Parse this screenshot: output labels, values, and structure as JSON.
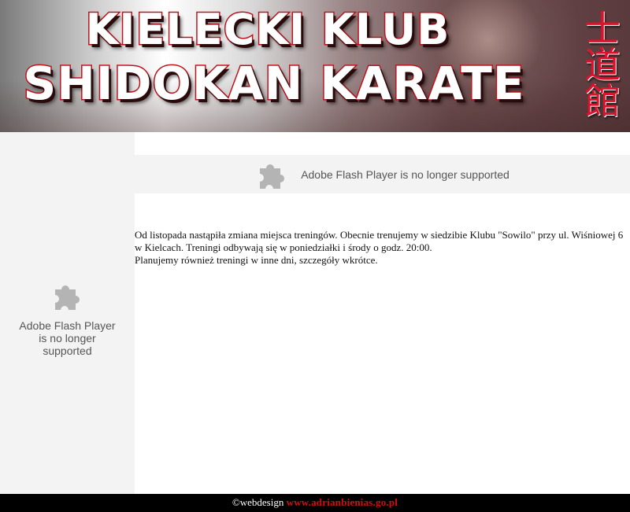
{
  "header": {
    "title_line1": "KIELECKI KLUB",
    "title_line2": "SHIDOKAN KARATE",
    "kanji": "士道館",
    "colors": {
      "title_outline": "#c0121a",
      "kanji": "#e0102a"
    }
  },
  "flash": {
    "main_message": "Adobe Flash Player is no longer supported",
    "sidebar_message": "Adobe Flash Player is no longer supported",
    "icon": "puzzle-piece-icon"
  },
  "content": {
    "paragraph1": "Od listopada nastąpiła zmiana miejsca treningów. Obecnie trenujemy w siedzibie Klubu \"Sowilo\" przy ul. Wiśniowej 6 w Kielcach. Treningi odbywają się w poniedziałki i środy o godz. 20:00.",
    "paragraph2": "Planujemy również treningi w inne dni, szczegóły wkrótce."
  },
  "footer": {
    "prefix": "©webdesign",
    "link_text": "www.adrianbienias.go.pl",
    "colors": {
      "background": "#000000",
      "link": "#d01010"
    }
  }
}
